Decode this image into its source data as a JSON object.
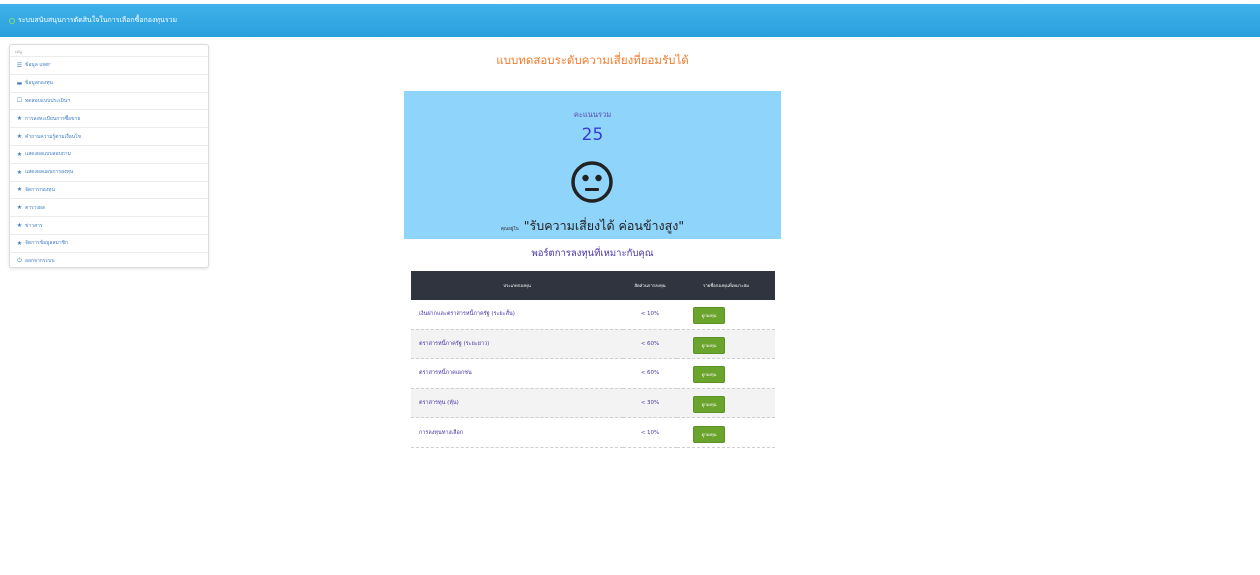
{
  "header": {
    "title": "ระบบสนับสนุนการตัดสินใจในการเลือกซื้อกองทุนรวม"
  },
  "sidebar": {
    "section_label": "เมนู",
    "items": [
      {
        "icon": "list-icon",
        "label": "ข้อมูล user"
      },
      {
        "icon": "folder-icon",
        "label": "ข้อมูลกองทุน"
      },
      {
        "icon": "checkbox-icon",
        "label": "ทดสอบแบบประเมินฯ"
      },
      {
        "icon": "star-icon",
        "label": "การลงทะเบียนการซื้อขาย"
      },
      {
        "icon": "star-icon",
        "label": "คำถามความรู้ตามเงื่อนไข"
      },
      {
        "icon": "star-icon",
        "label": "แสดงผลแบบสอบถาม"
      },
      {
        "icon": "star-icon",
        "label": "แสดงผลแผนการลงทุน"
      },
      {
        "icon": "star-icon",
        "label": "จัดการกองทุน"
      },
      {
        "icon": "star-icon",
        "label": "ตารางผล"
      },
      {
        "icon": "star-icon",
        "label": "ข่าวสาร"
      },
      {
        "icon": "star-icon",
        "label": "จัดการข้อมูลสมาชิก"
      },
      {
        "icon": "power-icon",
        "label": "ออกจากระบบ"
      }
    ]
  },
  "main": {
    "title": "แบบทดสอบระดับความเสี่ยงที่ยอมรับได้",
    "score_label": "คะแนนรวม",
    "score_value": "25",
    "face_icon": "neutral-face-icon",
    "result_prefix": "คุณอยู่ใน",
    "result_text": "\"รับความเสี่ยงได้ ค่อนข้างสูง\"",
    "portfolio_title": "พอร์ตการลงทุนที่เหมาะกับคุณ",
    "table": {
      "headers": [
        "ประเภทกองทุน",
        "สัดส่วนการลงทุน",
        "รายชื่อกองทุนที่เหมาะสม"
      ],
      "rows": [
        {
          "name": "เงินฝากและตราสารหนี้ภาครัฐ (ระยะสั้น)",
          "pct": "< 10%",
          "button": "ดูกองทุน"
        },
        {
          "name": "ตราสารหนี้ภาครัฐ (ระยะยาว)",
          "pct": "< 60%",
          "button": "ดูกองทุน"
        },
        {
          "name": "ตราสารหนี้ภาคเอกชน",
          "pct": "< 60%",
          "button": "ดูกองทุน"
        },
        {
          "name": "ตราสารทุน (หุ้น)",
          "pct": "< 30%",
          "button": "ดูกองทุน"
        },
        {
          "name": "การลงทุนทางเลือก",
          "pct": "< 10%",
          "button": "ดูกองทุน"
        }
      ]
    }
  },
  "colors": {
    "header": "#2ea3de",
    "accent_title": "#f07c2d",
    "score_box": "#8fd4fb",
    "button": "#6aa42d"
  }
}
